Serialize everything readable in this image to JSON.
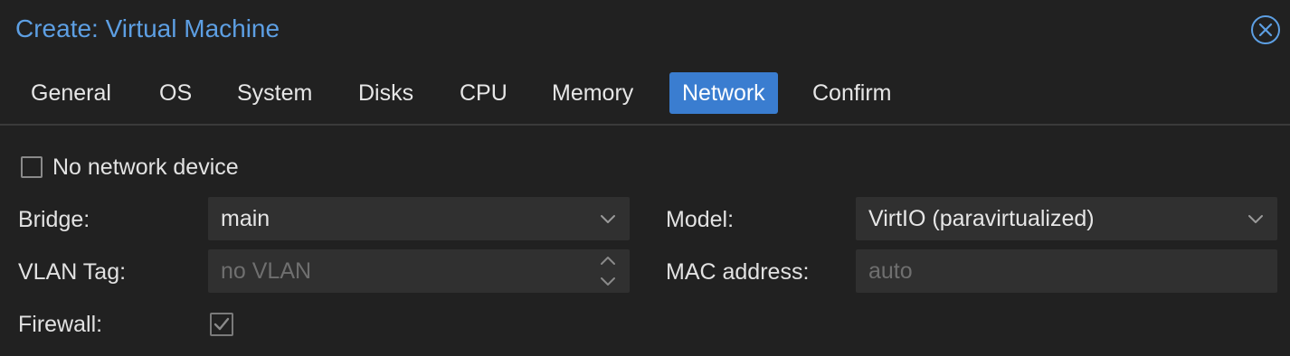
{
  "window": {
    "title": "Create: Virtual Machine",
    "close_icon": "close-circle-icon"
  },
  "tabs": [
    {
      "label": "General",
      "active": false
    },
    {
      "label": "OS",
      "active": false
    },
    {
      "label": "System",
      "active": false
    },
    {
      "label": "Disks",
      "active": false
    },
    {
      "label": "CPU",
      "active": false
    },
    {
      "label": "Memory",
      "active": false
    },
    {
      "label": "Network",
      "active": true
    },
    {
      "label": "Confirm",
      "active": false
    }
  ],
  "form": {
    "no_network_device": {
      "label": "No network device",
      "checked": false
    },
    "bridge": {
      "label": "Bridge:",
      "value": "main"
    },
    "vlan_tag": {
      "label": "VLAN Tag:",
      "placeholder": "no VLAN"
    },
    "firewall": {
      "label": "Firewall:",
      "checked": true
    },
    "model": {
      "label": "Model:",
      "value": "VirtIO (paravirtualized)"
    },
    "mac_address": {
      "label": "MAC address:",
      "placeholder": "auto"
    }
  },
  "colors": {
    "accent": "#3a7dd0",
    "title": "#5d9fe3",
    "background": "#212121",
    "field_background": "#303030"
  }
}
